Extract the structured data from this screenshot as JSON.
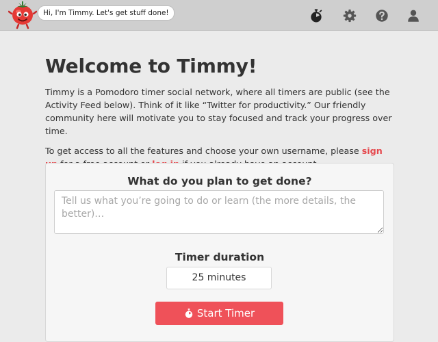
{
  "header": {
    "greeting": "Hi, I'm Timmy. Let's get stuff done!",
    "icons": [
      "tomato-mascot-icon",
      "stopwatch-icon",
      "gear-icon",
      "help-icon",
      "user-icon"
    ]
  },
  "main": {
    "title": "Welcome to Timmy!",
    "intro": "Timmy is a Pomodoro timer social network, where all timers are public (see the Activity Feed below). Think of it like “Twitter for productivity.” Our friendly community here will motivate you to stay focused and track your progress over time.",
    "access_before": "To get access to all the features and choose your own username, please ",
    "signup_link": "sign up",
    "access_middle": " for a free account or ",
    "login_link": "log in",
    "access_after": " if you already have an account."
  },
  "timer_form": {
    "plan_label": "What do you plan to get done?",
    "plan_placeholder": "Tell us what you’re going to do or learn (the more details, the better)…",
    "plan_value": "",
    "duration_label": "Timer duration",
    "duration_value": "25 minutes",
    "start_button": "Start Timer"
  },
  "colors": {
    "header_bg": "#cfcfcf",
    "page_bg": "#ebebeb",
    "accent_red": "#ef5159",
    "link_red": "#e5484d",
    "text": "#333333"
  }
}
